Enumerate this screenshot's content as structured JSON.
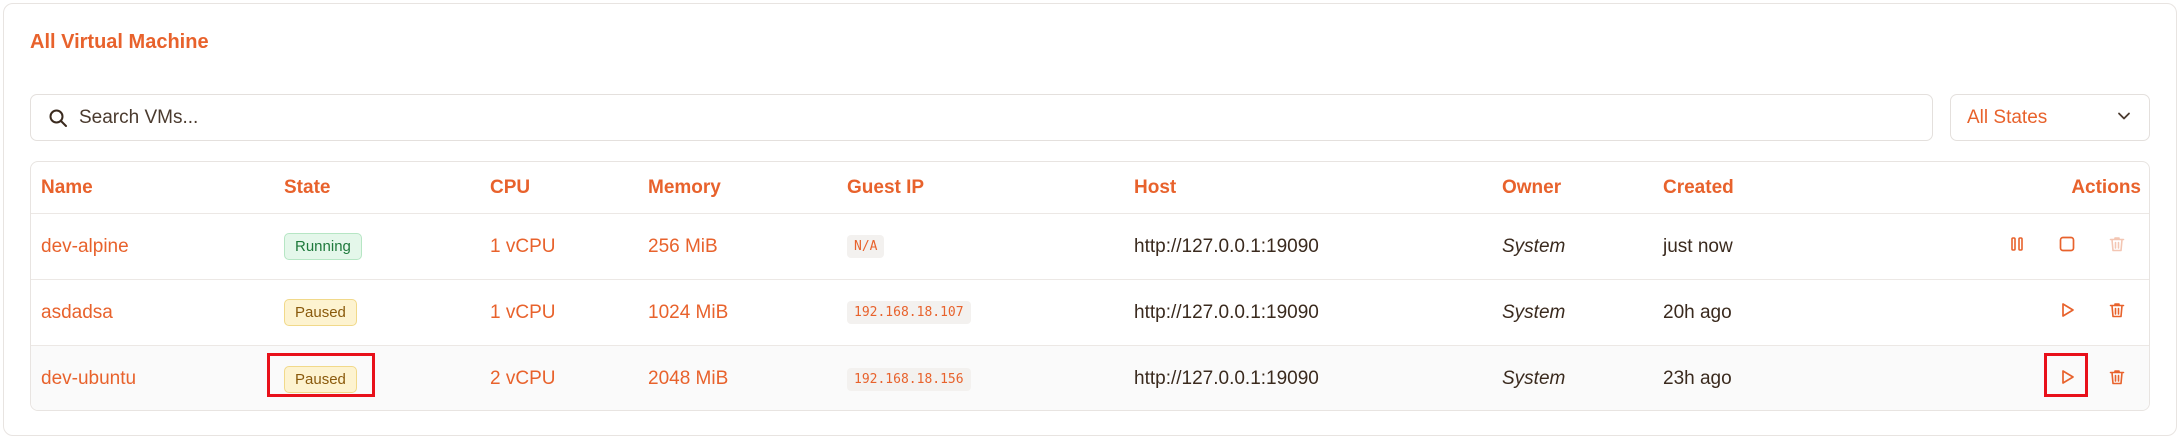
{
  "title": "All Virtual Machine",
  "search": {
    "placeholder": "Search VMs..."
  },
  "filter": {
    "selected": "All States"
  },
  "columns": {
    "name": "Name",
    "state": "State",
    "cpu": "CPU",
    "memory": "Memory",
    "guest_ip": "Guest IP",
    "host": "Host",
    "owner": "Owner",
    "created": "Created",
    "actions": "Actions"
  },
  "rows": [
    {
      "name": "dev-alpine",
      "state": "Running",
      "cpu": "1 vCPU",
      "memory": "256 MiB",
      "guest_ip": "N/A",
      "host": "http://127.0.0.1:19090",
      "owner": "System",
      "created": "just now"
    },
    {
      "name": "asdadsa",
      "state": "Paused",
      "cpu": "1 vCPU",
      "memory": "1024 MiB",
      "guest_ip": "192.168.18.107",
      "host": "http://127.0.0.1:19090",
      "owner": "System",
      "created": "20h ago"
    },
    {
      "name": "dev-ubuntu",
      "state": "Paused",
      "cpu": "2 vCPU",
      "memory": "2048 MiB",
      "guest_ip": "192.168.18.156",
      "host": "http://127.0.0.1:19090",
      "owner": "System",
      "created": "23h ago"
    }
  ],
  "colors": {
    "accent": "#e8622c",
    "highlight": "#e8101a"
  }
}
